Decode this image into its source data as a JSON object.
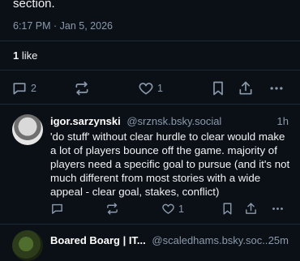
{
  "post": {
    "text_tail": "section.",
    "timestamp": "6:17 PM · Jan 5, 2026",
    "likes_count": "1",
    "likes_label": "like",
    "actions": {
      "reply_count": "2",
      "like_count": "1"
    }
  },
  "replies": [
    {
      "display_name": "igor.sarzynski",
      "handle": "@srznsk.bsky.social",
      "time": "1h",
      "text": "'do stuff' without clear hurdle to clear would make a lot of players bounce off the game. majority of players need a specific goal to pursue (and it's not much different from most stories with a wide appeal - clear goal, stakes, conflict)",
      "actions": {
        "reply_count": "",
        "like_count": "1"
      }
    },
    {
      "display_name": "Boared Boarg | IT...",
      "handle": "@scaledhams.bsky.soc...",
      "time": "25m"
    }
  ],
  "colors": {
    "background": "#0b1017",
    "muted": "#8a99ab",
    "divider": "#1e2a38",
    "text": "#ffffff"
  }
}
